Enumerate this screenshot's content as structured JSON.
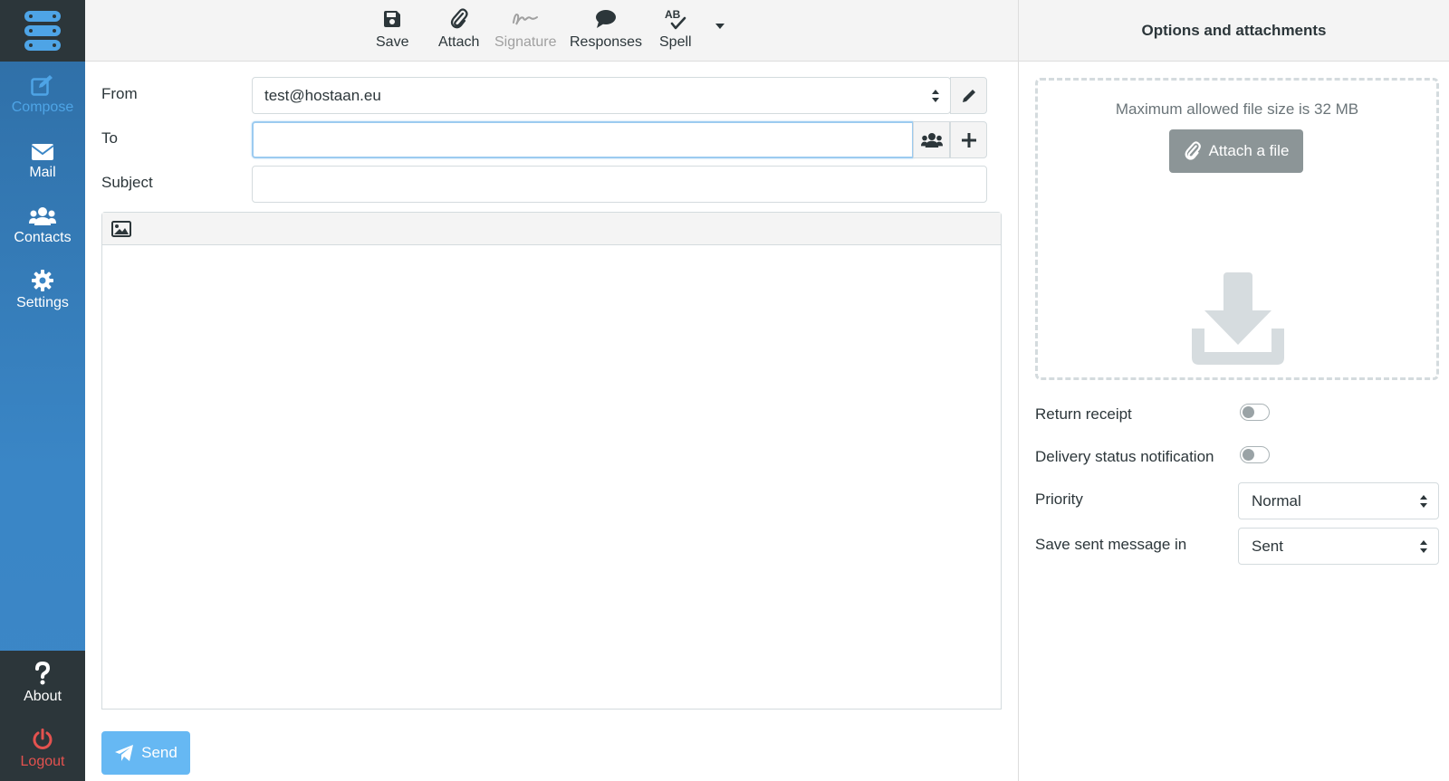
{
  "nav": {
    "items": [
      {
        "label": "Compose",
        "icon": "compose-icon",
        "active": true
      },
      {
        "label": "Mail",
        "icon": "mail-icon"
      },
      {
        "label": "Contacts",
        "icon": "contacts-icon"
      },
      {
        "label": "Settings",
        "icon": "gear-icon"
      }
    ],
    "bottom": [
      {
        "label": "About",
        "icon": "question-icon"
      },
      {
        "label": "Logout",
        "icon": "power-icon"
      }
    ]
  },
  "toolbar": {
    "save": "Save",
    "attach": "Attach",
    "signature": "Signature",
    "responses": "Responses",
    "spell": "Spell"
  },
  "form": {
    "from_label": "From",
    "from_value": "test@hostaan.eu",
    "to_label": "To",
    "to_value": "",
    "subject_label": "Subject",
    "subject_value": ""
  },
  "send_label": "Send",
  "panel": {
    "title": "Options and attachments",
    "max_size_note": "Maximum allowed file size is 32 MB",
    "attach_label": "Attach a file",
    "return_receipt_label": "Return receipt",
    "return_receipt_on": false,
    "dsn_label": "Delivery status notification",
    "dsn_on": false,
    "priority_label": "Priority",
    "priority_value": "Normal",
    "save_sent_label": "Save sent message in",
    "save_sent_value": "Sent"
  },
  "colors": {
    "accent": "#4ea4e6",
    "nav": "#3a86c6",
    "dark": "#2c363a",
    "logout": "#e4524f",
    "send": "#66b8f3"
  }
}
